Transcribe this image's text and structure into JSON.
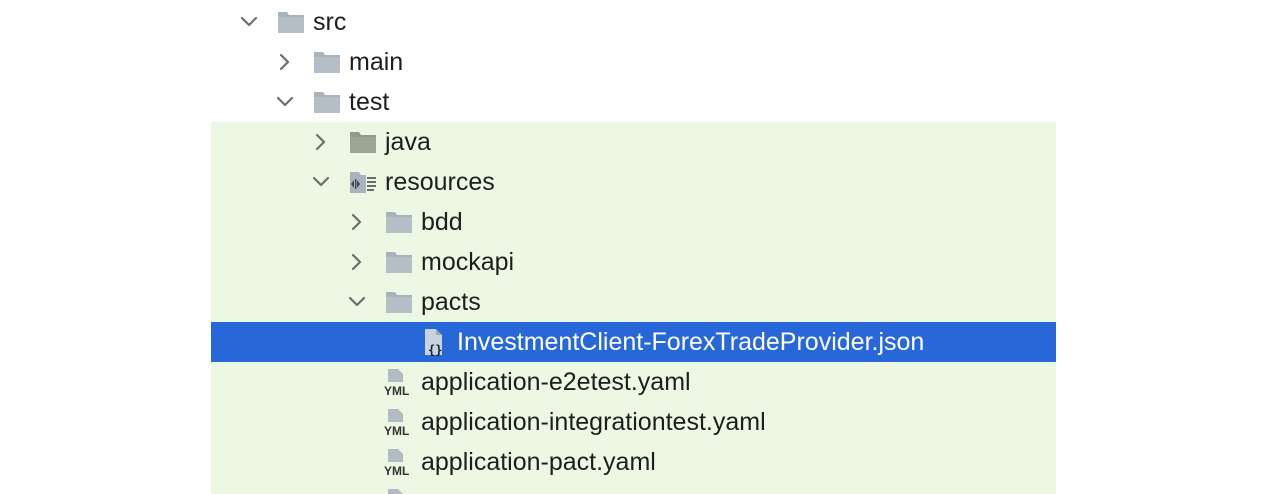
{
  "tree": {
    "nodes": [
      {
        "label": "src",
        "icon": "folder-icon",
        "expand": "expanded"
      },
      {
        "label": "main",
        "icon": "folder-icon",
        "expand": "collapsed"
      },
      {
        "label": "test",
        "icon": "folder-icon",
        "expand": "expanded"
      },
      {
        "label": "java",
        "icon": "test-sources-folder-icon",
        "expand": "collapsed"
      },
      {
        "label": "resources",
        "icon": "test-resources-folder-icon",
        "expand": "expanded"
      },
      {
        "label": "bdd",
        "icon": "folder-icon",
        "expand": "collapsed"
      },
      {
        "label": "mockapi",
        "icon": "folder-icon",
        "expand": "collapsed"
      },
      {
        "label": "pacts",
        "icon": "folder-icon",
        "expand": "expanded"
      },
      {
        "label": "InvestmentClient-ForexTradeProvider.json",
        "icon": "json-file-icon",
        "selected": true
      },
      {
        "label": "application-e2etest.yaml",
        "icon": "yaml-file-icon",
        "icon_text": "YML"
      },
      {
        "label": "application-integrationtest.yaml",
        "icon": "yaml-file-icon",
        "icon_text": "YML"
      },
      {
        "label": "application-pact.yaml",
        "icon": "yaml-file-icon",
        "icon_text": "YML"
      }
    ]
  },
  "colors": {
    "test_scope_background": "#ecf8e4",
    "selection": "#2767d8",
    "folder": "#a9b3bd",
    "text": "#1e1e1e"
  }
}
